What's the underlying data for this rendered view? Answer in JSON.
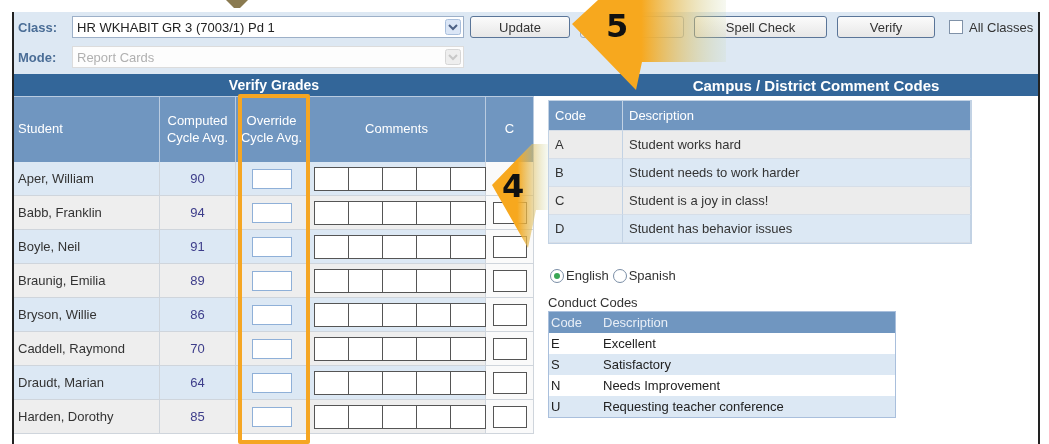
{
  "toolbar": {
    "class_label": "Class:",
    "class_value": "HR WKHABIT GR 3 (7003/1) Pd 1",
    "mode_label": "Mode:",
    "mode_value": "Report Cards",
    "mode_disabled": true,
    "buttons": [
      {
        "label": "Update",
        "obscured": false
      },
      {
        "obscured": true
      },
      {
        "label": "Spell Check",
        "obscured": false
      },
      {
        "label": "Verify",
        "obscured": false
      }
    ],
    "all_classes": {
      "label": "All Classes",
      "checked": false
    }
  },
  "grades": {
    "title": "Verify Grades",
    "columns": [
      "Student",
      "Computed Cycle Avg.",
      "Override Cycle Avg.",
      "Comments",
      "C"
    ],
    "rows": [
      {
        "student": "Aper, William",
        "computed": "90"
      },
      {
        "student": "Babb, Franklin",
        "computed": "94"
      },
      {
        "student": "Boyle, Neil",
        "computed": "91"
      },
      {
        "student": "Braunig, Emilia",
        "computed": "89"
      },
      {
        "student": "Bryson, Willie",
        "computed": "86"
      },
      {
        "student": "Caddell, Raymond",
        "computed": "70"
      },
      {
        "student": "Draudt, Marian",
        "computed": "64"
      },
      {
        "student": "Harden, Dorothy",
        "computed": "85"
      }
    ]
  },
  "comment_codes": {
    "title": "Campus / District Comment Codes",
    "columns": [
      "Code",
      "Description"
    ],
    "rows": [
      {
        "code": "A",
        "description": "Student works hard"
      },
      {
        "code": "B",
        "description": "Student needs to work harder"
      },
      {
        "code": "C",
        "description": "Student is a joy in class!"
      },
      {
        "code": "D",
        "description": "Student has behavior issues"
      }
    ],
    "languages": [
      {
        "label": "English",
        "selected": true
      },
      {
        "label": "Spanish",
        "selected": false
      }
    ],
    "conduct": {
      "title": "Conduct Codes",
      "columns": [
        "Code",
        "Description"
      ],
      "rows": [
        {
          "code": "E",
          "description": "Excellent"
        },
        {
          "code": "S",
          "description": "Satisfactory"
        },
        {
          "code": "N",
          "description": "Needs Improvement"
        },
        {
          "code": "U",
          "description": "Requesting teacher conference"
        }
      ]
    }
  },
  "callouts": [
    {
      "number": "5"
    },
    {
      "number": "4"
    }
  ]
}
